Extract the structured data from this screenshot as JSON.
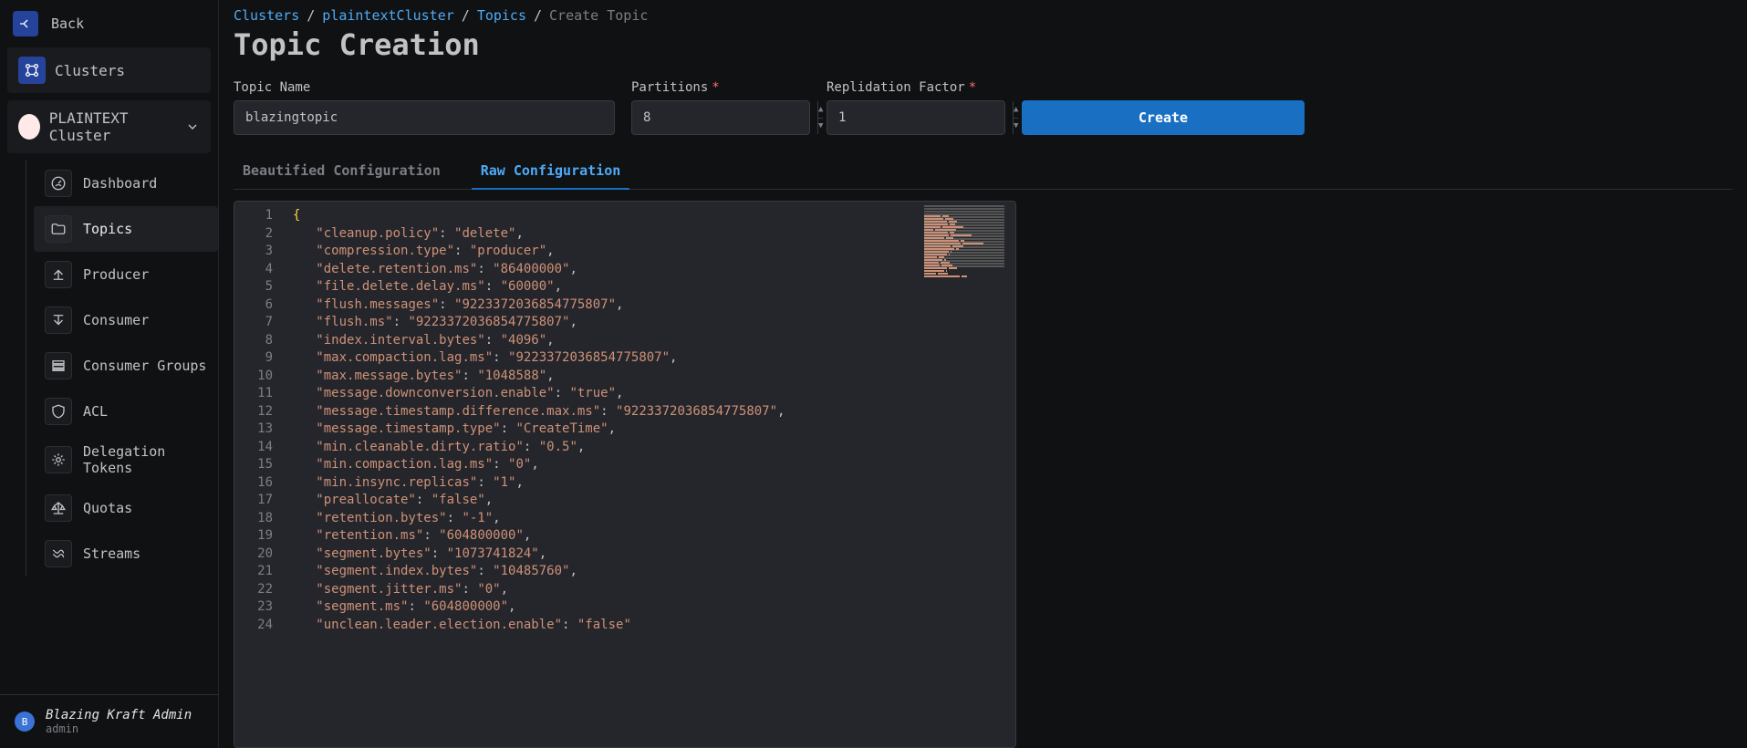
{
  "sidebar": {
    "back_label": "Back",
    "clusters_label": "Clusters",
    "cluster_selected": "PLAINTEXT Cluster",
    "nav": {
      "dashboard": "Dashboard",
      "topics": "Topics",
      "producer": "Producer",
      "consumer": "Consumer",
      "consumer_groups": "Consumer Groups",
      "acl": "ACL",
      "delegation_tokens": "Delegation Tokens",
      "quotas": "Quotas",
      "streams": "Streams"
    },
    "footer": {
      "badge": "B",
      "name": "Blazing Kraft Admin",
      "sub": "admin"
    }
  },
  "breadcrumb": {
    "clusters": "Clusters",
    "cluster": "plaintextCluster",
    "topics": "Topics",
    "current": "Create Topic",
    "sep": "/"
  },
  "page_title": "Topic Creation",
  "form": {
    "topic_name_label": "Topic Name",
    "topic_name_value": "blazingtopic",
    "partitions_label": "Partitions",
    "partitions_value": "8",
    "replication_label": "Replidation Factor",
    "replication_value": "1",
    "create_label": "Create"
  },
  "tabs": {
    "beautified": "Beautified Configuration",
    "raw": "Raw Configuration"
  },
  "config_entries": [
    [
      "cleanup.policy",
      "delete"
    ],
    [
      "compression.type",
      "producer"
    ],
    [
      "delete.retention.ms",
      "86400000"
    ],
    [
      "file.delete.delay.ms",
      "60000"
    ],
    [
      "flush.messages",
      "9223372036854775807"
    ],
    [
      "flush.ms",
      "9223372036854775807"
    ],
    [
      "index.interval.bytes",
      "4096"
    ],
    [
      "max.compaction.lag.ms",
      "9223372036854775807"
    ],
    [
      "max.message.bytes",
      "1048588"
    ],
    [
      "message.downconversion.enable",
      "true"
    ],
    [
      "message.timestamp.difference.max.ms",
      "9223372036854775807"
    ],
    [
      "message.timestamp.type",
      "CreateTime"
    ],
    [
      "min.cleanable.dirty.ratio",
      "0.5"
    ],
    [
      "min.compaction.lag.ms",
      "0"
    ],
    [
      "min.insync.replicas",
      "1"
    ],
    [
      "preallocate",
      "false"
    ],
    [
      "retention.bytes",
      "-1"
    ],
    [
      "retention.ms",
      "604800000"
    ],
    [
      "segment.bytes",
      "1073741824"
    ],
    [
      "segment.index.bytes",
      "10485760"
    ],
    [
      "segment.jitter.ms",
      "0"
    ],
    [
      "segment.ms",
      "604800000"
    ],
    [
      "unclean.leader.election.enable",
      "false"
    ]
  ]
}
